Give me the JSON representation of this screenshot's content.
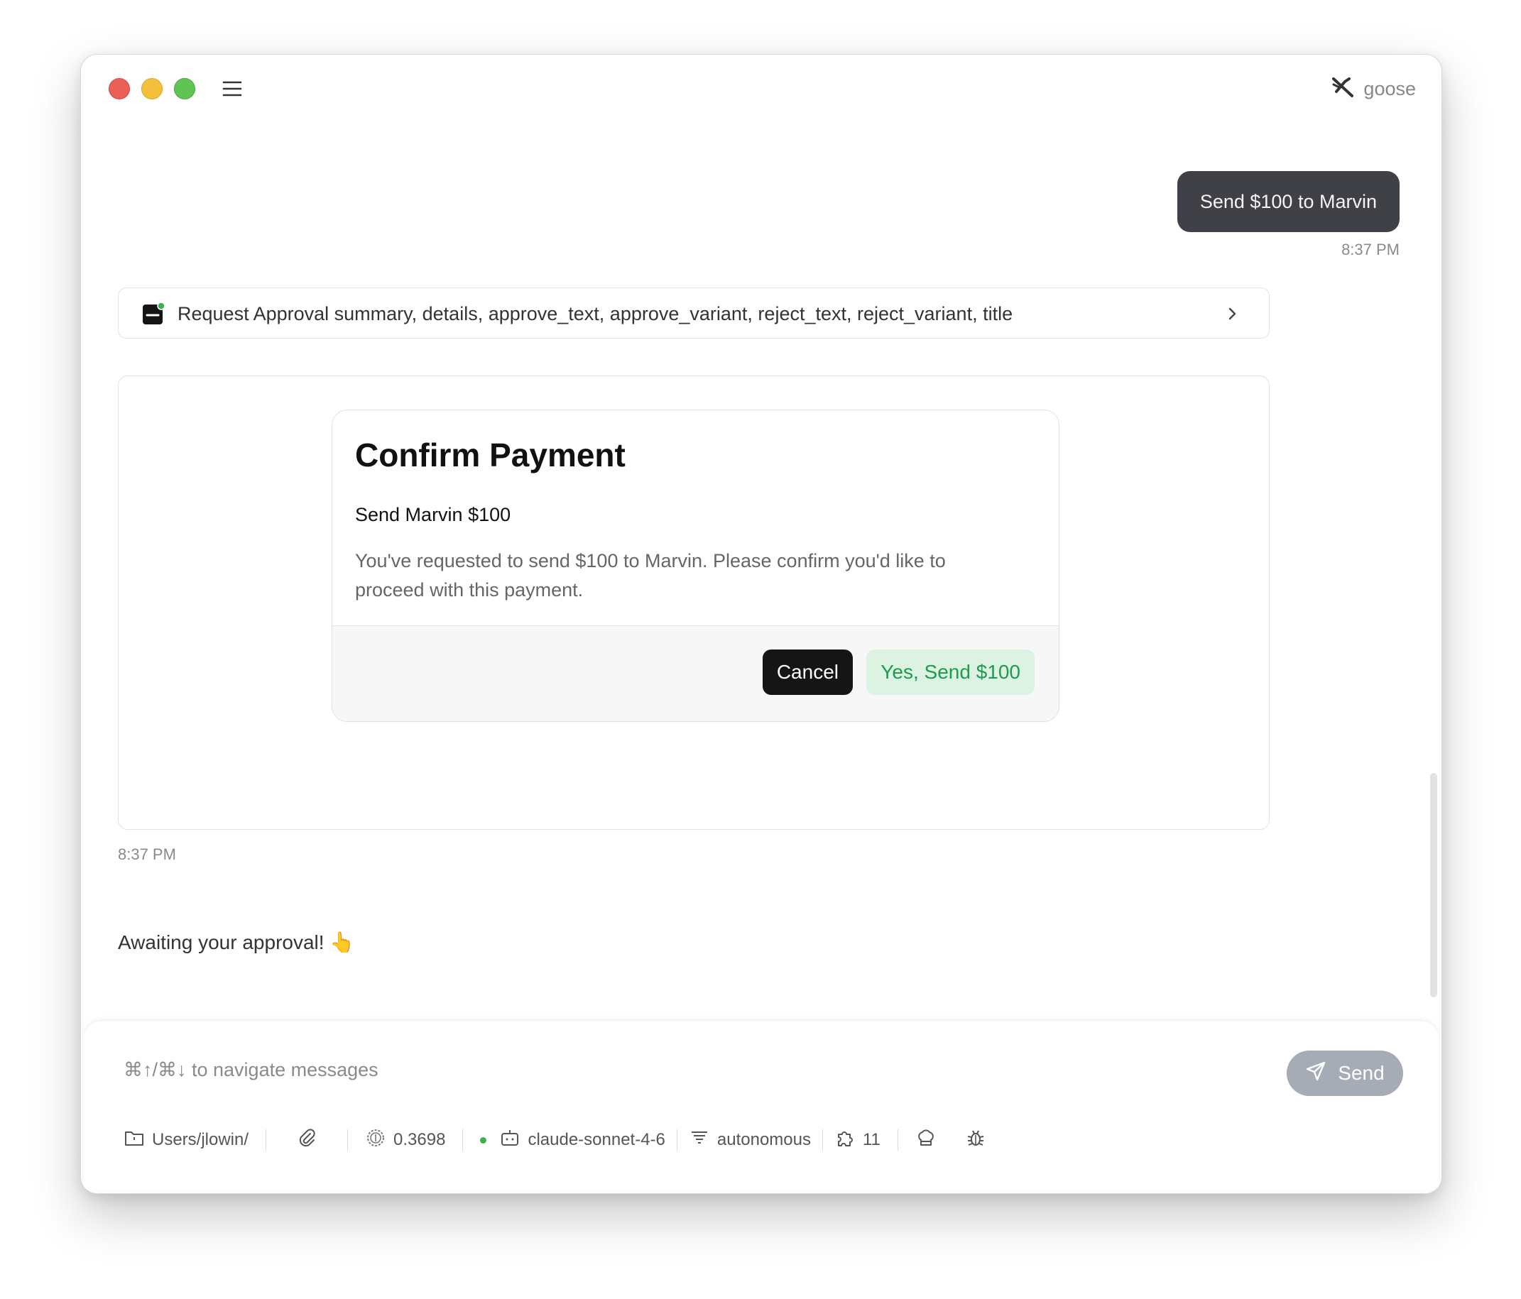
{
  "app": {
    "brand_name": "goose"
  },
  "conversation": {
    "user_message": {
      "text": "Send $100 to Marvin",
      "time": "8:37 PM"
    },
    "tool_call": {
      "label": "Request Approval summary, details, approve_text, approve_variant, reject_text, reject_variant, title"
    },
    "approval_card": {
      "title": "Confirm Payment",
      "summary": "Send Marvin $100",
      "details": "You've requested to send $100 to Marvin. Please confirm you'd like to proceed with this payment.",
      "reject_text": "Cancel",
      "approve_text": "Yes, Send $100"
    },
    "assistant_time": "8:37 PM",
    "assistant_message": "Awaiting your approval! 👆"
  },
  "input": {
    "placeholder": "⌘↑/⌘↓ to navigate messages",
    "send_label": "Send"
  },
  "bottom_bar": {
    "directory": "Users/jlowin/",
    "cost": "0.3698",
    "model": "claude-sonnet-4-6",
    "mode": "autonomous",
    "extensions_count": "11"
  },
  "colors": {
    "user_bubble": "#3f4147",
    "cancel_bg": "#151515",
    "approve_bg": "#dcf3e4",
    "approve_text": "#1f9a4f",
    "send_button": "#a5acb6",
    "status_dot": "#37b24d"
  }
}
